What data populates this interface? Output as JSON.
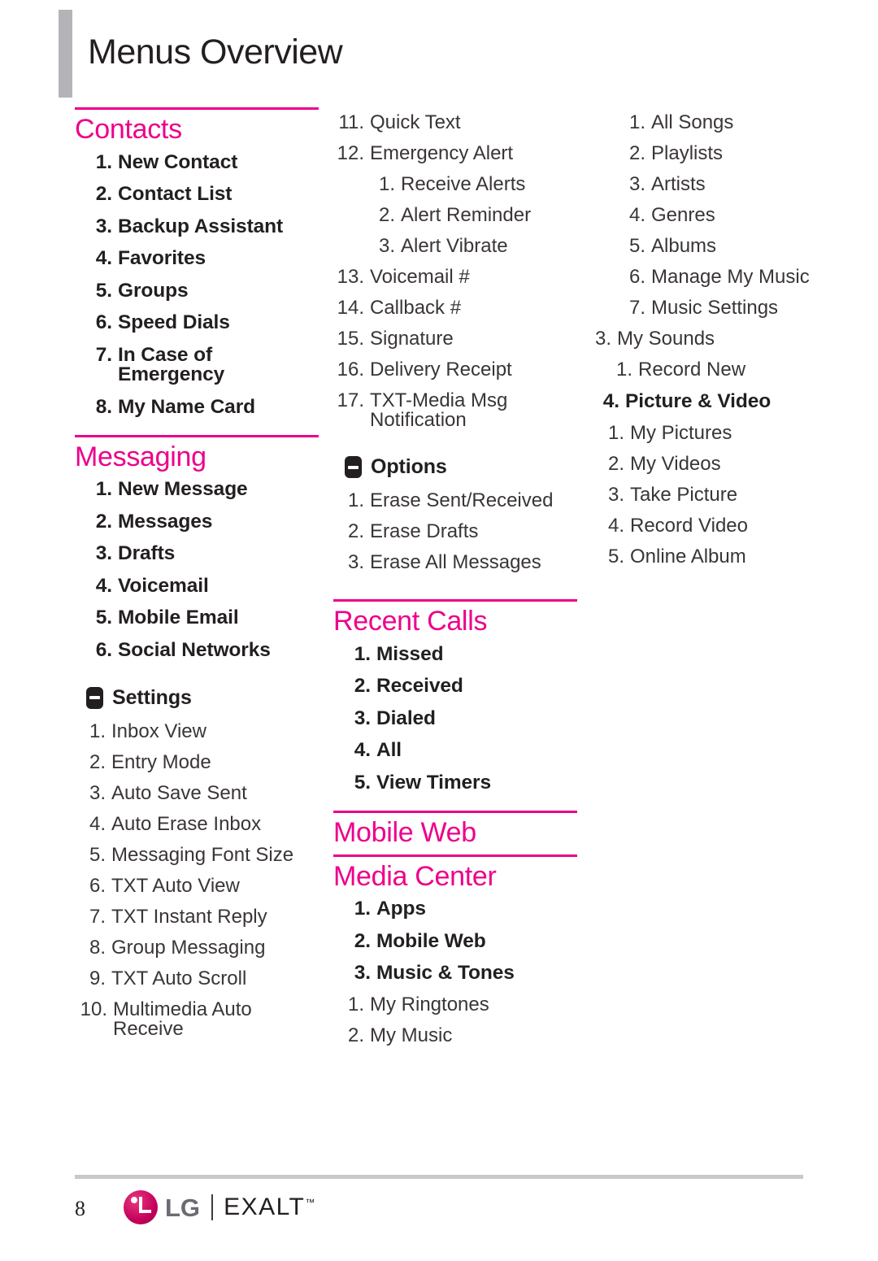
{
  "page": {
    "title": "Menus Overview",
    "number": "8",
    "accent_color": "#EC008C",
    "title_bar_color": "#B4B4B8",
    "text_color": "#231F20"
  },
  "brand": {
    "logo_icon": "lg-circle-logo",
    "name": "LG",
    "separator": "|",
    "product": "EXALT",
    "trademark": "™"
  },
  "columns": [
    {
      "id": "column-1",
      "sections": [
        {
          "title": "Contacts",
          "items": [
            {
              "num": "1.",
              "label": "New Contact",
              "level": 1
            },
            {
              "num": "2.",
              "label": "Contact List",
              "level": 1
            },
            {
              "num": "3.",
              "label": "Backup Assistant",
              "level": 1
            },
            {
              "num": "4.",
              "label": "Favorites",
              "level": 1
            },
            {
              "num": "5.",
              "label": "Groups",
              "level": 1
            },
            {
              "num": "6.",
              "label": "Speed Dials",
              "level": 1
            },
            {
              "num": "7.",
              "label": "In Case of Emergency",
              "level": 1
            },
            {
              "num": "8.",
              "label": "My Name Card",
              "level": 1
            }
          ]
        },
        {
          "title": "Messaging",
          "items": [
            {
              "num": "1.",
              "label": "New Message",
              "level": 1
            },
            {
              "num": "2.",
              "label": "Messages",
              "level": 1
            },
            {
              "num": "3.",
              "label": "Drafts",
              "level": 1
            },
            {
              "num": "4.",
              "label": "Voicemail",
              "level": 1
            },
            {
              "num": "5.",
              "label": "Mobile Email",
              "level": 1
            },
            {
              "num": "6.",
              "label": "Social Networks",
              "level": 1
            }
          ],
          "subgroup": {
            "icon": "minus-box-icon",
            "label": "Settings",
            "items": [
              {
                "num": "1.",
                "label": "Inbox View",
                "level": 2
              },
              {
                "num": "2.",
                "label": "Entry Mode",
                "level": 2
              },
              {
                "num": "3.",
                "label": "Auto Save Sent",
                "level": 2
              },
              {
                "num": "4.",
                "label": "Auto Erase Inbox",
                "level": 2
              },
              {
                "num": "5.",
                "label": "Messaging Font Size",
                "level": 2
              },
              {
                "num": "6.",
                "label": "TXT Auto View",
                "level": 2
              },
              {
                "num": "7.",
                "label": "TXT Instant Reply",
                "level": 2
              },
              {
                "num": "8.",
                "label": "Group Messaging",
                "level": 2
              },
              {
                "num": "9.",
                "label": "TXT Auto Scroll",
                "level": 2
              },
              {
                "num": "10.",
                "label": "Multimedia Auto\nReceive",
                "level": 2
              }
            ]
          }
        }
      ]
    },
    {
      "id": "column-2",
      "continued_items": [
        {
          "num": "11.",
          "label": "Quick Text",
          "level": 2
        },
        {
          "num": "12.",
          "label": "Emergency Alert",
          "level": 2
        },
        {
          "num": "1.",
          "label": "Receive Alerts",
          "level": 3
        },
        {
          "num": "2.",
          "label": "Alert Reminder",
          "level": 3
        },
        {
          "num": "3.",
          "label": "Alert Vibrate",
          "level": 3
        },
        {
          "num": "13.",
          "label": "Voicemail #",
          "level": 2
        },
        {
          "num": "14.",
          "label": "Callback #",
          "level": 2
        },
        {
          "num": "15.",
          "label": "Signature",
          "level": 2
        },
        {
          "num": "16.",
          "label": "Delivery Receipt",
          "level": 2
        },
        {
          "num": "17.",
          "label": "TXT-Media Msg\nNotification",
          "level": 2
        }
      ],
      "subgroup": {
        "icon": "minus-box-icon",
        "label": "Options",
        "items": [
          {
            "num": "1.",
            "label": "Erase Sent/Received",
            "level": 2
          },
          {
            "num": "2.",
            "label": "Erase Drafts",
            "level": 2
          },
          {
            "num": "3.",
            "label": "Erase All Messages",
            "level": 2
          }
        ]
      },
      "sections": [
        {
          "title": "Recent Calls",
          "items": [
            {
              "num": "1.",
              "label": "Missed",
              "level": 1
            },
            {
              "num": "2.",
              "label": "Received",
              "level": 1
            },
            {
              "num": "3.",
              "label": "Dialed",
              "level": 1
            },
            {
              "num": "4.",
              "label": "All",
              "level": 1
            },
            {
              "num": "5.",
              "label": "View Timers",
              "level": 1
            }
          ]
        },
        {
          "title": "Mobile Web",
          "items": []
        },
        {
          "title": "Media Center",
          "items": [
            {
              "num": "1.",
              "label": "Apps",
              "level": 1
            },
            {
              "num": "2.",
              "label": "Mobile Web",
              "level": 1
            },
            {
              "num": "3.",
              "label": "Music & Tones",
              "level": 1
            },
            {
              "num": "1.",
              "label": "My Ringtones",
              "level": 2
            },
            {
              "num": "2.",
              "label": "My Music",
              "level": 2
            }
          ]
        }
      ]
    },
    {
      "id": "column-3",
      "continued_items": [
        {
          "num": "1.",
          "label": "All Songs",
          "level": 3
        },
        {
          "num": "2.",
          "label": "Playlists",
          "level": 3
        },
        {
          "num": "3.",
          "label": "Artists",
          "level": 3
        },
        {
          "num": "4.",
          "label": "Genres",
          "level": 3
        },
        {
          "num": "5.",
          "label": "Albums",
          "level": 3
        },
        {
          "num": "6.",
          "label": "Manage My Music",
          "level": 3
        },
        {
          "num": "7.",
          "label": "Music Settings",
          "level": 3
        },
        {
          "num": "3.",
          "label": "My Sounds",
          "level": 2
        },
        {
          "num": "1.",
          "label": "Record New",
          "level": 3
        },
        {
          "num": "4.",
          "label": "Picture & Video",
          "level": 1
        },
        {
          "num": "1.",
          "label": "My Pictures",
          "level": 2
        },
        {
          "num": "2.",
          "label": "My Videos",
          "level": 2
        },
        {
          "num": "3.",
          "label": "Take Picture",
          "level": 2
        },
        {
          "num": "4.",
          "label": "Record Video",
          "level": 2
        },
        {
          "num": "5.",
          "label": "Online Album",
          "level": 2
        }
      ]
    }
  ]
}
